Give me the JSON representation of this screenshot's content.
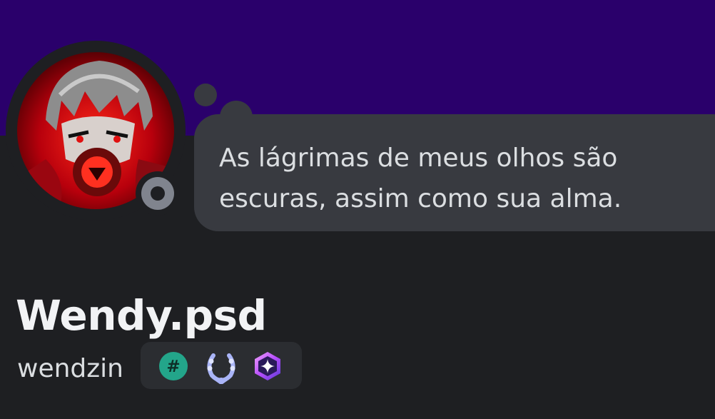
{
  "profile": {
    "display_name": "Wendy.psd",
    "username": "wendzin",
    "status_bubble": {
      "line1": "As lágrimas de meus olhos são",
      "line2": "escuras, assim como sua alma."
    },
    "presence": "offline",
    "badges": [
      {
        "icon": "hashtag-badge-icon",
        "color": "#23a58a"
      },
      {
        "icon": "laurel-badge-icon",
        "color": "#a9b4f7"
      },
      {
        "icon": "gem-badge-icon",
        "color": "#b64dfb"
      }
    ],
    "avatar": {
      "icon": "avatar-image",
      "dominant_color": "#d0141b"
    }
  },
  "colors": {
    "banner": "#2a006b",
    "background": "#1e1f22",
    "bubble": "#383a40",
    "badges_container": "#2b2d31"
  }
}
